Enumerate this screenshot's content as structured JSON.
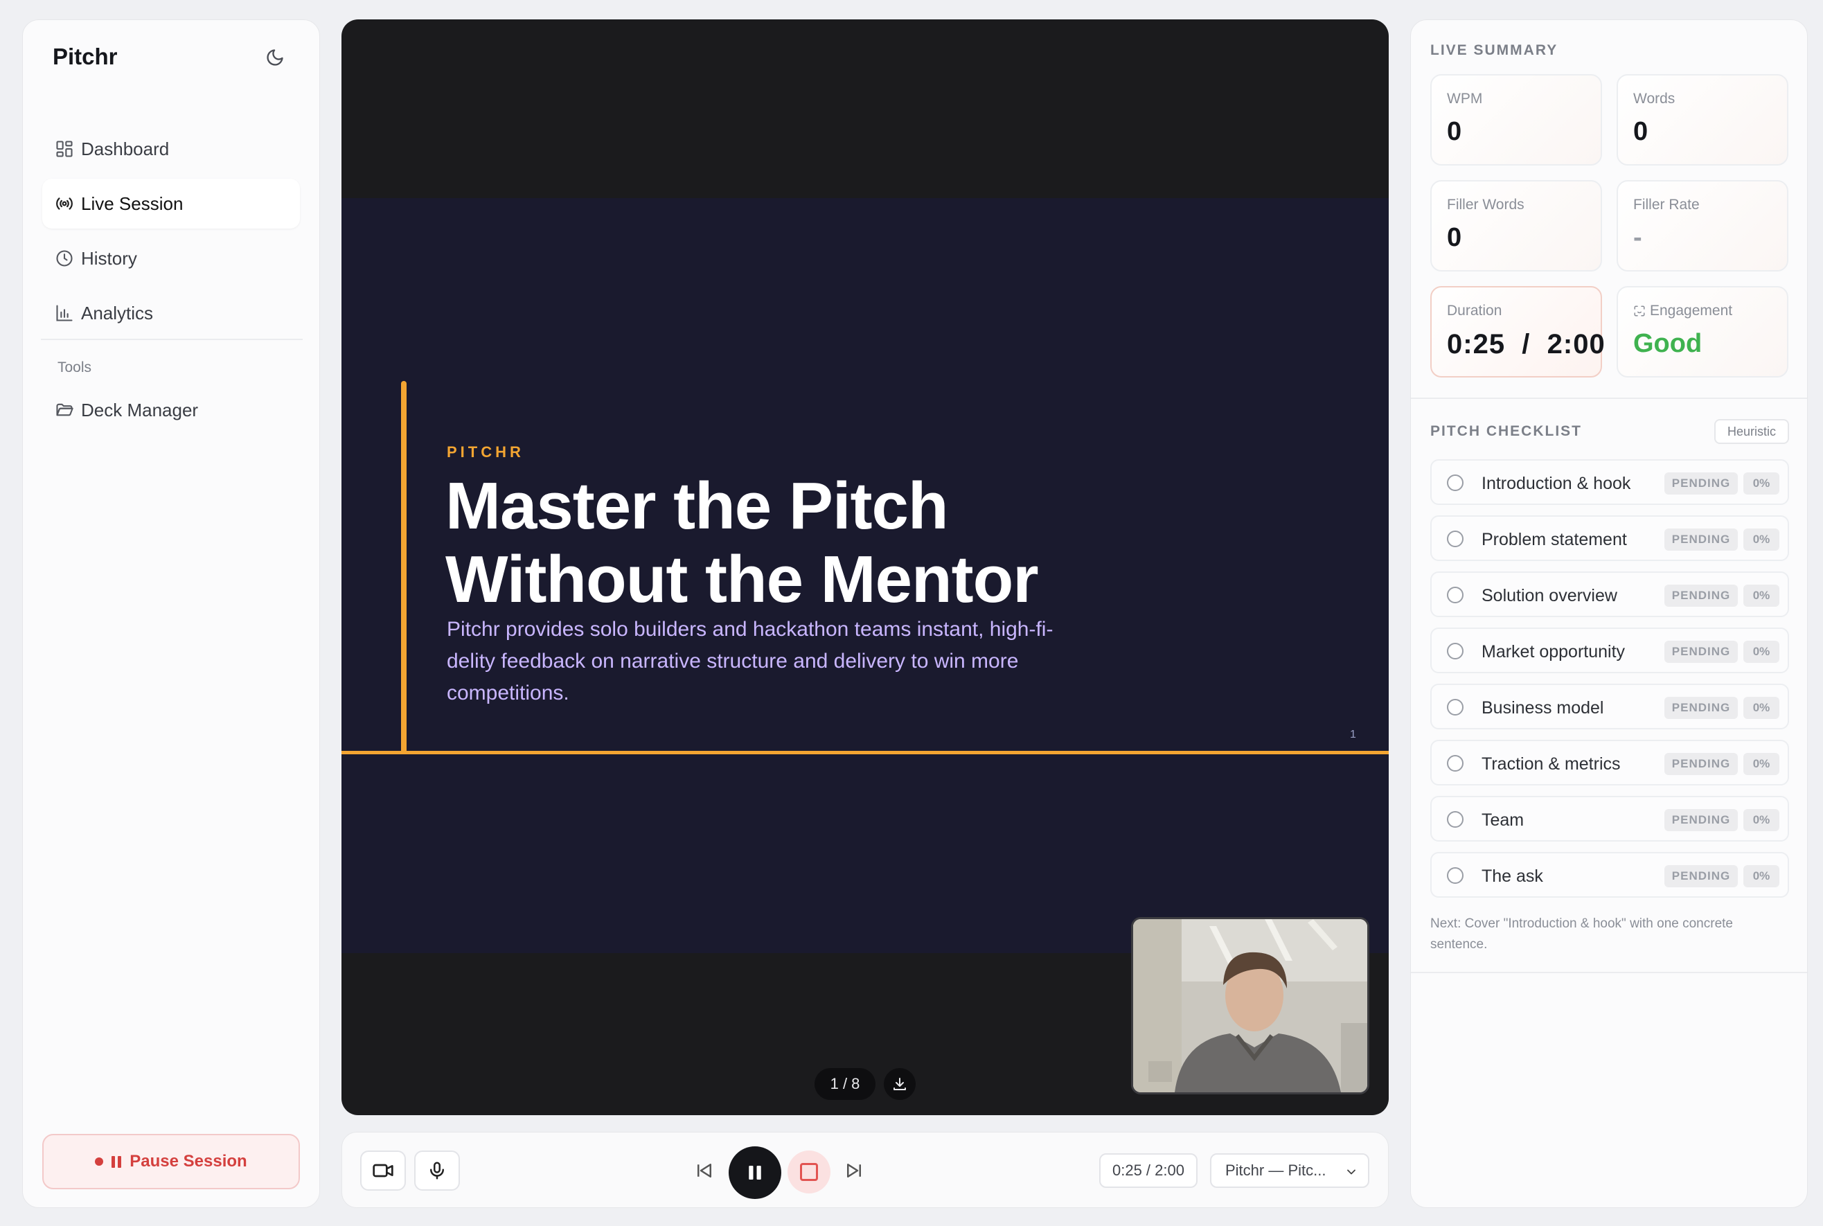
{
  "sidebar": {
    "brand": "Pitchr",
    "nav": [
      {
        "label": "Dashboard",
        "icon": "dashboard-icon"
      },
      {
        "label": "Live Session",
        "icon": "broadcast-icon",
        "active": true
      },
      {
        "label": "History",
        "icon": "clock-icon"
      },
      {
        "label": "Analytics",
        "icon": "bar-chart-icon"
      }
    ],
    "tools_heading": "Tools",
    "tools": [
      {
        "label": "Deck Manager",
        "icon": "folder-icon"
      }
    ],
    "pause_label": "Pause Session"
  },
  "slide": {
    "eyebrow": "PITCHR",
    "title_line1": "Master the Pitch",
    "title_line2": "Without the Mentor",
    "body": "Pitchr provides solo builders and hackathon teams instant, high-fi- delity feedback on narrative structure and delivery to win more competitions.",
    "number": "1",
    "page_indicator": "1 / 8"
  },
  "controls": {
    "time": "0:25 / 2:00",
    "deck": "Pitchr — Pitc..."
  },
  "summary": {
    "heading": "LIVE SUMMARY",
    "wpm": {
      "label": "WPM",
      "value": "0"
    },
    "words": {
      "label": "Words",
      "value": "0"
    },
    "filler_words": {
      "label": "Filler Words",
      "value": "0"
    },
    "filler_rate": {
      "label": "Filler Rate",
      "value": "-"
    },
    "duration": {
      "label": "Duration",
      "value": "0:25  /  2:00"
    },
    "engagement": {
      "label": "Engagement",
      "value": "Good"
    }
  },
  "checklist": {
    "heading": "PITCH CHECKLIST",
    "badge": "Heuristic",
    "items": [
      {
        "name": "Introduction & hook",
        "status": "PENDING",
        "pct": "0%"
      },
      {
        "name": "Problem statement",
        "status": "PENDING",
        "pct": "0%"
      },
      {
        "name": "Solution overview",
        "status": "PENDING",
        "pct": "0%"
      },
      {
        "name": "Market opportunity",
        "status": "PENDING",
        "pct": "0%"
      },
      {
        "name": "Business model",
        "status": "PENDING",
        "pct": "0%"
      },
      {
        "name": "Traction & metrics",
        "status": "PENDING",
        "pct": "0%"
      },
      {
        "name": "Team",
        "status": "PENDING",
        "pct": "0%"
      },
      {
        "name": "The ask",
        "status": "PENDING",
        "pct": "0%"
      }
    ],
    "next_hint": "Next: Cover \"Introduction & hook\" with one concrete sentence."
  },
  "colors": {
    "accent": "#f3a532",
    "slide_bg": "#1a1a2e",
    "engagement_good": "#3fb24f",
    "danger": "#d4403e"
  }
}
